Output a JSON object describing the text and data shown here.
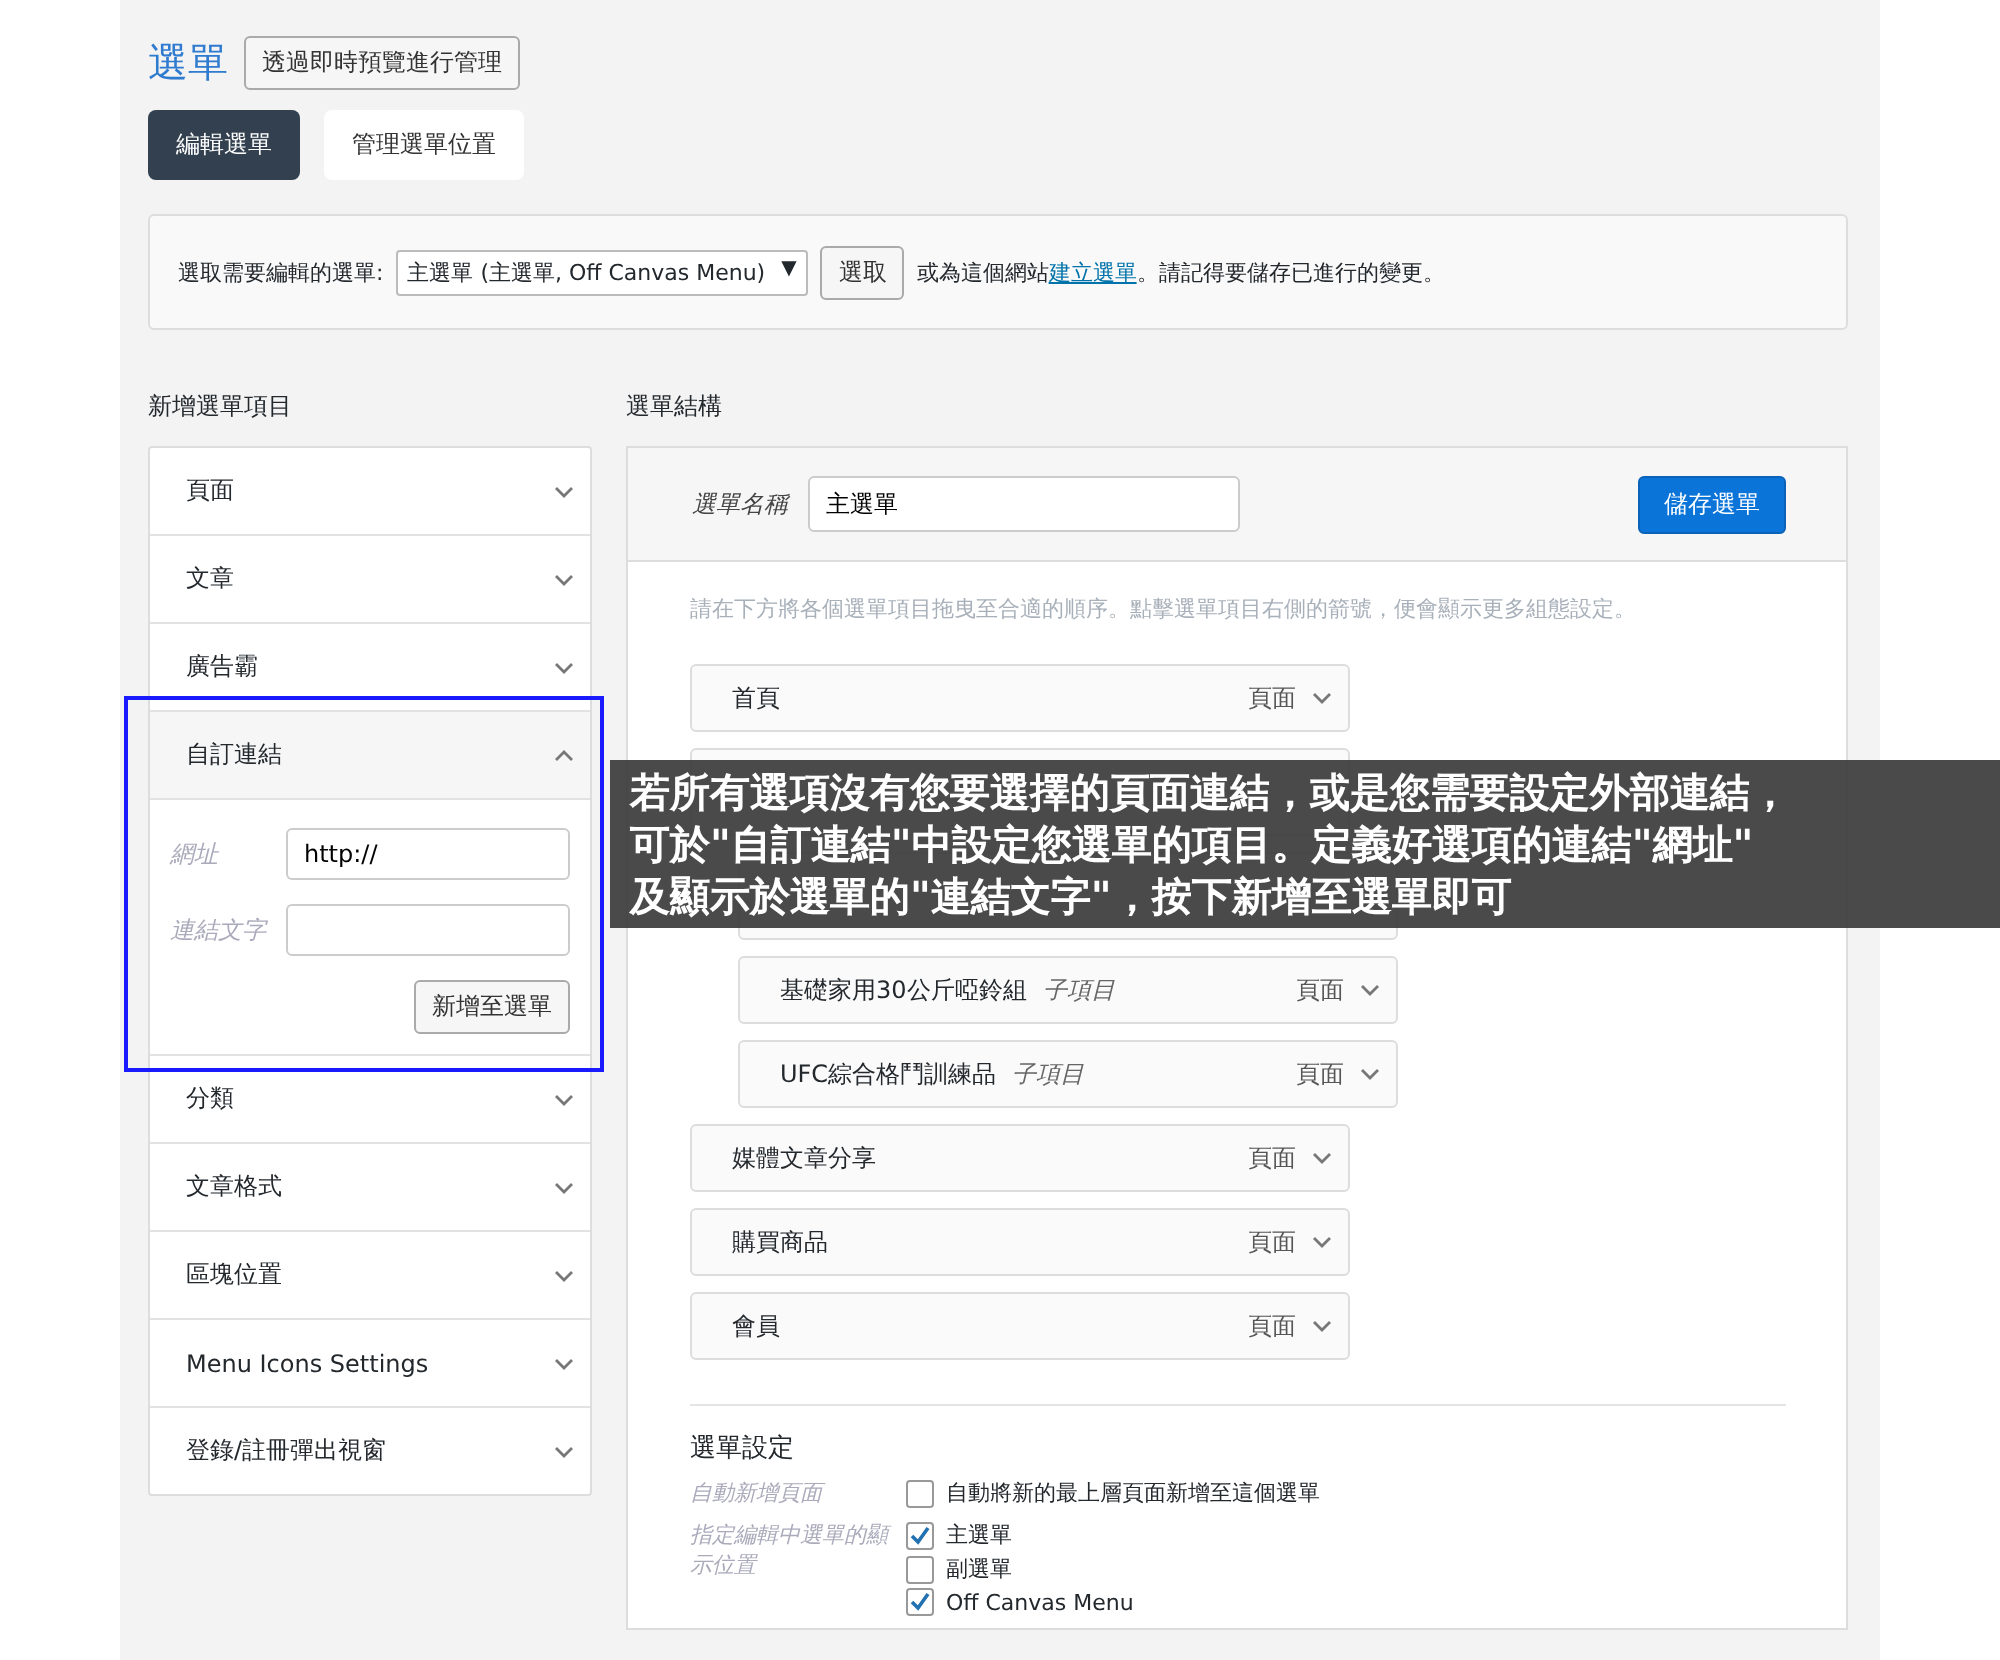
{
  "page_title": "選單",
  "preview_button": "透過即時預覽進行管理",
  "tabs": [
    {
      "label": "編輯選單",
      "selected": true
    },
    {
      "label": "管理選單位置",
      "selected": false
    }
  ],
  "select_bar": {
    "label": "選取需要編輯的選單:",
    "dropdown": "主選單 (主選單, Off Canvas Menu)",
    "dropdown_arrow": "▼",
    "select_button": "選取",
    "text_before_link": "或為這個網站",
    "link": "建立選單",
    "text_after_link": "。請記得要儲存已進行的變更。"
  },
  "add_items": {
    "heading": "新增選單項目",
    "sections": [
      {
        "label": "頁面",
        "expanded": false
      },
      {
        "label": "文章",
        "expanded": false
      },
      {
        "label": "廣告霸",
        "expanded": false
      },
      {
        "label": "自訂連結",
        "expanded": true,
        "highlighted": true,
        "fields": [
          {
            "label": "網址",
            "value": "http://"
          },
          {
            "label": "連結文字"
          }
        ],
        "button": "新增至選單"
      },
      {
        "label": "分類",
        "expanded": false
      },
      {
        "label": "文章格式",
        "expanded": false
      },
      {
        "label": "區塊位置",
        "expanded": false
      },
      {
        "label": "Menu Icons Settings",
        "expanded": false
      },
      {
        "label": "登錄/註冊彈出視窗",
        "expanded": false
      }
    ]
  },
  "structure": {
    "heading": "選單結構",
    "name_label": "選單名稱",
    "name_value": "主選單",
    "save_button": "儲存選單",
    "instructions": "請在下方將各個選單項目拖曳至合適的順序。點擊選單項目右側的箭號，便會顯示更多組態設定。",
    "items": [
      {
        "title": "首頁",
        "type": "頁面"
      },
      {
        "covered": true,
        "children": [
          {
            "covered": true
          },
          {
            "title": "基礎家用30公斤啞鈴組",
            "sub": "子項目",
            "type": "頁面"
          },
          {
            "title": "UFC綜合格鬥訓練品",
            "sub": "子項目",
            "type": "頁面"
          }
        ]
      },
      {
        "title": "媒體文章分享",
        "type": "頁面"
      },
      {
        "title": "購買商品",
        "type": "頁面"
      },
      {
        "title": "會員",
        "type": "頁面"
      }
    ],
    "settings": {
      "heading": "選單設定",
      "rows": [
        {
          "label": "自動新增頁面",
          "options": [
            {
              "label": "自動將新的最上層頁面新增至這個選單",
              "checked": false
            }
          ]
        },
        {
          "label": "指定編輯中選單的顯示位置",
          "options": [
            {
              "label": "主選單",
              "checked": true
            },
            {
              "label": "副選單",
              "checked": false
            },
            {
              "label": "Off Canvas Menu",
              "checked": true
            }
          ]
        }
      ]
    }
  },
  "annotation": {
    "lines": [
      "若所有選項沒有您要選擇的頁面連結，或是您需要設定外部連結，",
      "可於\"自訂連結\"中設定您選單的項目。定義好選項的連結\"網址\"",
      "及顯示於選單的\"連結文字\"，按下新增至選單即可"
    ]
  }
}
